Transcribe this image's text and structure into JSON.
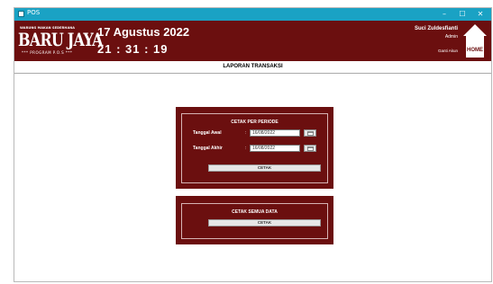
{
  "window": {
    "title": "POS",
    "controls": {
      "minimize": "–",
      "maximize": "☐",
      "close": "✕"
    }
  },
  "header": {
    "logo": {
      "top_text": "WARUNG MAKAN SEDERHANA",
      "name": "BARU JAYA",
      "sub_text": "*** PROGRAM P.O.S ***"
    },
    "date": "17 Agustus 2022",
    "time": "21 : 31 : 19",
    "user": {
      "name": "Suci Zuldesfianti",
      "role": "Admin"
    },
    "logout_label": "Ganti Akun",
    "home_label": "HOME"
  },
  "page": {
    "title": "LAPORAN TRANSAKSI"
  },
  "period_panel": {
    "title": "CETAK PER PERIODE",
    "start_label": "Tanggal Awal",
    "start_value": "16/08/2022",
    "end_label": "Tanggal Akhir",
    "end_value": "16/08/2022",
    "colon": ":",
    "print_label": "CETAK"
  },
  "all_panel": {
    "title": "CETAK SEMUA DATA",
    "print_label": "CETAK"
  },
  "colors": {
    "brand": "#6b0f0f",
    "titlebar": "#1aa2c4"
  },
  "icons": [
    "window-icon",
    "home-icon",
    "calendar-icon"
  ]
}
